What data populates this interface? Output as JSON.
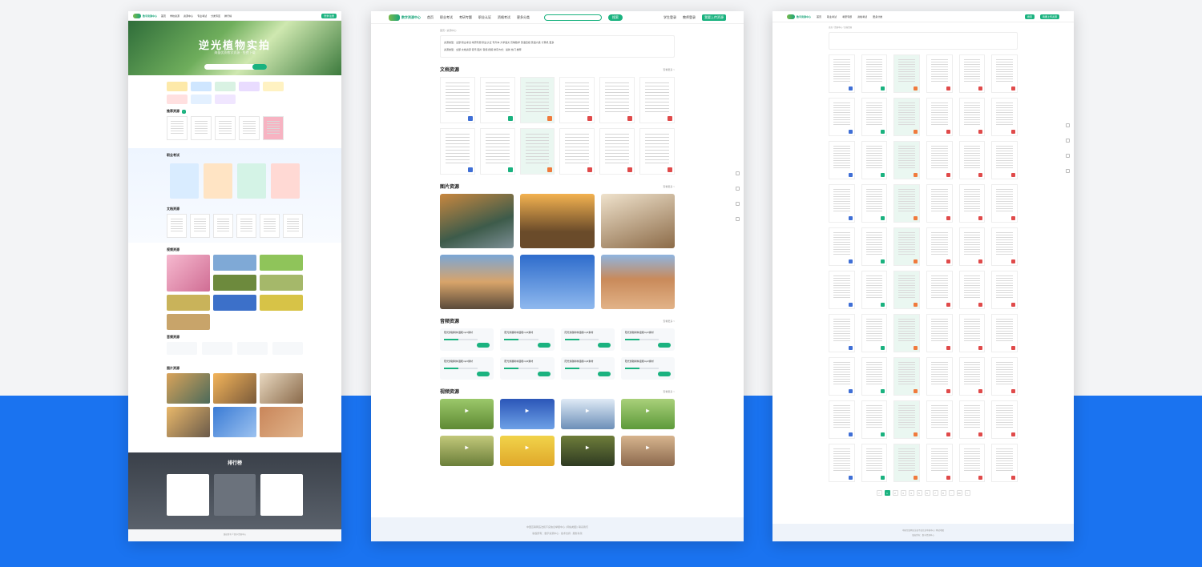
{
  "brand": {
    "name": "数字资源中心",
    "accent": "#1ab27f",
    "backdrop_blue": "#1a73f0"
  },
  "home": {
    "nav": [
      "首页",
      "学校资源",
      "资源中心",
      "专业考试",
      "分类专区",
      "排行榜"
    ],
    "login_button": "登录/注册",
    "hero_title": "逆光植物实拍",
    "hero_subtitle": "海量优质教学资源 · 免费下载",
    "sections": {
      "recommend": "推荐资源",
      "exam": "职业考试",
      "docs": "文档资源",
      "video": "视频资源",
      "audio": "音频资源",
      "pictures": "图片资源"
    },
    "rank_title": "排行榜",
    "footer": "版权所有 © 数字资源中心"
  },
  "list": {
    "nav": [
      "首页",
      "职业考试",
      "考研专题",
      "职业认证",
      "资格考试",
      "更多分类"
    ],
    "search_button": "搜索",
    "user_links": [
      "学生登录",
      "教师登录"
    ],
    "upload_button": "我要上传资源",
    "breadcrumb": "首页 / 资源中心",
    "filter_rows": [
      "资源类型：全部 职业考试 考研专题 职业认证 专升本 大学语文 高等数学 英语四级 英语六级 计算机 更多",
      "资源类型：全部 文档资源 音乐 图片 音频 视频 排序方式：最新 热门 推荐"
    ],
    "sections": {
      "docs": "文档资源",
      "pictures": "图片资源",
      "audio": "音频资源",
      "video": "视频资源"
    },
    "more": "查看更多 >",
    "audio_title": "阳光穿越树林温暖mp3素材",
    "audio_button": "立即下载",
    "footer_line1": "中国互联网违法和不良信息举报中心 | 网站地图 | 联系我们",
    "footer_line2": "版权所有：数字资源中心 · 技术支持 · 服务条款"
  },
  "catalog": {
    "nav": [
      "首页",
      "职业考试",
      "考研专题",
      "资格考试",
      "更多分类"
    ],
    "search_button": "搜索",
    "upload_button": "我要上传资源",
    "breadcrumb": "首页 / 资源中心 / 文档资源",
    "pages": [
      "<",
      "1",
      "2",
      "3",
      "4",
      "5",
      "6",
      "7",
      "8",
      "...",
      "20",
      ">"
    ],
    "footer_line1": "中国互联网违法和不良信息举报中心 | 网站地图",
    "footer_line2": "版权所有：数字资源中心"
  }
}
